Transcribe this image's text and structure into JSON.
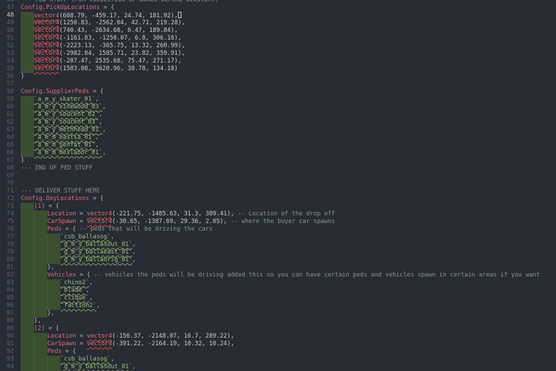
{
  "editor": {
    "current_line": 48,
    "lines": [
      {
        "n": 46,
        "indent": 0,
        "tokens": [
          [
            "comment",
            "--- PED STUFF (FOR COLLECTION OF BOXES BEFORE DELIVERY)"
          ]
        ]
      },
      {
        "n": 47,
        "indent": 0,
        "tokens": [
          [
            "field",
            "Config.PickUpLocations"
          ],
          [
            "op",
            " = {"
          ]
        ]
      },
      {
        "n": 48,
        "indent": 1,
        "tokens": [
          [
            "fn",
            "vector4"
          ],
          [
            "num",
            "(608.79, -459.17, 24.74, 181.92),"
          ]
        ],
        "cursor": true
      },
      {
        "n": 49,
        "indent": 1,
        "tokens": [
          [
            "fn",
            "vector4"
          ],
          [
            "num",
            "(1250.83, -2562.04, 42.71, 219.28),"
          ]
        ]
      },
      {
        "n": 50,
        "indent": 1,
        "tokens": [
          [
            "fn",
            "vector4"
          ],
          [
            "num",
            "(740.43, -2634.68, 6.47, 189.84),"
          ]
        ]
      },
      {
        "n": 51,
        "indent": 1,
        "tokens": [
          [
            "fn",
            "vector4"
          ],
          [
            "num",
            "(-1161.83, -1250.07, 6.8, 306.16),"
          ]
        ]
      },
      {
        "n": 52,
        "indent": 1,
        "tokens": [
          [
            "fn",
            "vector4"
          ],
          [
            "num",
            "(-2223.13, -365.75, 13.32, 260.99),"
          ]
        ]
      },
      {
        "n": 53,
        "indent": 1,
        "tokens": [
          [
            "fn",
            "vector4"
          ],
          [
            "num",
            "(-2982.84, 1585.71, 23.82, 359.91),"
          ]
        ]
      },
      {
        "n": 54,
        "indent": 1,
        "tokens": [
          [
            "fn",
            "vector4"
          ],
          [
            "num",
            "(-287.47, 2535.68, 75.47, 271.17),"
          ]
        ]
      },
      {
        "n": 55,
        "indent": 1,
        "tokens": [
          [
            "fn",
            "vector4"
          ],
          [
            "num",
            "(1583.08, 3620.96, 38.78, 134.18)"
          ]
        ]
      },
      {
        "n": 56,
        "indent": 0,
        "tokens": [
          [
            "op",
            "}"
          ]
        ]
      },
      {
        "n": 57,
        "indent": 0,
        "tokens": []
      },
      {
        "n": 58,
        "indent": 0,
        "tokens": [
          [
            "field",
            "Config.SupplierPeds"
          ],
          [
            "op",
            " = {"
          ]
        ]
      },
      {
        "n": 59,
        "indent": 1,
        "tokens": [
          [
            "str",
            "`a_m_y_skater_01`"
          ],
          [
            "op",
            ","
          ]
        ]
      },
      {
        "n": 60,
        "indent": 1,
        "tokens": [
          [
            "str",
            "`a_m_y_vinewood_03`"
          ],
          [
            "op",
            ","
          ]
        ]
      },
      {
        "n": 61,
        "indent": 1,
        "tokens": [
          [
            "str",
            "`a_m_y_soucent_02`"
          ],
          [
            "op",
            ","
          ]
        ]
      },
      {
        "n": 62,
        "indent": 1,
        "tokens": [
          [
            "str",
            "`a_m_y_soucent_03`"
          ],
          [
            "op",
            ","
          ]
        ]
      },
      {
        "n": 63,
        "indent": 1,
        "tokens": [
          [
            "str",
            "`a_m_y_methhead_01`"
          ],
          [
            "op",
            ","
          ]
        ]
      },
      {
        "n": 64,
        "indent": 1,
        "tokens": [
          [
            "str",
            "`a_m_m_eastsa_01`"
          ],
          [
            "op",
            ","
          ]
        ]
      },
      {
        "n": 65,
        "indent": 1,
        "tokens": [
          [
            "str",
            "`a_m_m_genfat_01`"
          ],
          [
            "op",
            ","
          ]
        ]
      },
      {
        "n": 66,
        "indent": 1,
        "tokens": [
          [
            "str",
            "`a_m_m_mexlabor_01`"
          ],
          [
            "op",
            ","
          ]
        ]
      },
      {
        "n": 67,
        "indent": 0,
        "tokens": [
          [
            "op",
            "}"
          ]
        ]
      },
      {
        "n": 68,
        "indent": 0,
        "tokens": [
          [
            "comment",
            "--- END OF PED STUFF"
          ]
        ]
      },
      {
        "n": 69,
        "indent": 0,
        "tokens": []
      },
      {
        "n": 70,
        "indent": 0,
        "tokens": []
      },
      {
        "n": 71,
        "indent": 0,
        "tokens": [
          [
            "comment",
            "--- DELIVER STUFF HERE"
          ]
        ]
      },
      {
        "n": 72,
        "indent": 0,
        "tokens": [
          [
            "field",
            "Config.OxyLocations"
          ],
          [
            "op",
            " = {"
          ]
        ]
      },
      {
        "n": 73,
        "indent": 1,
        "tokens": [
          [
            "field",
            "[1]"
          ],
          [
            "op",
            " = {"
          ]
        ]
      },
      {
        "n": 74,
        "indent": 2,
        "tokens": [
          [
            "field",
            "Location"
          ],
          [
            "op",
            " = "
          ],
          [
            "fn",
            "vector4"
          ],
          [
            "num",
            "(-221.75, -1485.63, 31.3, 309.41),"
          ],
          [
            "comment",
            " -- Location of the drop off"
          ]
        ]
      },
      {
        "n": 75,
        "indent": 2,
        "tokens": [
          [
            "field",
            "CarSpawn"
          ],
          [
            "op",
            " = "
          ],
          [
            "fn",
            "vector4"
          ],
          [
            "num",
            "(-30.65, -1387.69, 29.36, 2.05),"
          ],
          [
            "comment",
            " -- where the buyer car spawns"
          ]
        ]
      },
      {
        "n": 76,
        "indent": 2,
        "tokens": [
          [
            "field",
            "Peds"
          ],
          [
            "op",
            " = { "
          ],
          [
            "comment",
            "-- peds that will be driving the cars"
          ]
        ]
      },
      {
        "n": 77,
        "indent": 3,
        "tokens": [
          [
            "str",
            "`csb_ballasog`"
          ],
          [
            "op",
            ","
          ]
        ]
      },
      {
        "n": 78,
        "indent": 3,
        "tokens": [
          [
            "str",
            "`g_m_y_ballasout_01`"
          ],
          [
            "op",
            ","
          ]
        ]
      },
      {
        "n": 79,
        "indent": 3,
        "tokens": [
          [
            "str",
            "`g_m_y_ballaeast_01`"
          ],
          [
            "op",
            ","
          ]
        ]
      },
      {
        "n": 80,
        "indent": 3,
        "tokens": [
          [
            "str",
            "`g_m_y_ballaorig_01`"
          ],
          [
            "op",
            ","
          ]
        ]
      },
      {
        "n": 81,
        "indent": 2,
        "tokens": [
          [
            "op",
            "},"
          ]
        ]
      },
      {
        "n": 82,
        "indent": 2,
        "tokens": [
          [
            "field",
            "Vehicles"
          ],
          [
            "op",
            " = { "
          ],
          [
            "comment",
            "-- vehicles the peds will be driving added this so you can have certain peds and vehicles spawn in certain areas if you want"
          ]
        ]
      },
      {
        "n": 83,
        "indent": 3,
        "tokens": [
          [
            "str",
            "`chino2`"
          ],
          [
            "op",
            ","
          ]
        ]
      },
      {
        "n": 84,
        "indent": 3,
        "tokens": [
          [
            "str",
            "`blade`"
          ],
          [
            "op",
            ","
          ]
        ]
      },
      {
        "n": 85,
        "indent": 3,
        "tokens": [
          [
            "str",
            "`clique`"
          ],
          [
            "op",
            ","
          ]
        ]
      },
      {
        "n": 86,
        "indent": 3,
        "tokens": [
          [
            "str",
            "`faction2`"
          ],
          [
            "op",
            ","
          ]
        ]
      },
      {
        "n": 87,
        "indent": 2,
        "tokens": [
          [
            "op",
            "},"
          ]
        ]
      },
      {
        "n": 88,
        "indent": 1,
        "tokens": [
          [
            "op",
            "},"
          ]
        ]
      },
      {
        "n": 89,
        "indent": 1,
        "tokens": [
          [
            "field",
            "[2]"
          ],
          [
            "op",
            " = {"
          ]
        ]
      },
      {
        "n": 90,
        "indent": 2,
        "tokens": [
          [
            "field",
            "Location"
          ],
          [
            "op",
            " = "
          ],
          [
            "fn",
            "vector4"
          ],
          [
            "num",
            "(-156.37, -2148.07, 16.7, 289.22),"
          ]
        ]
      },
      {
        "n": 91,
        "indent": 2,
        "tokens": [
          [
            "field",
            "CarSpawn"
          ],
          [
            "op",
            " = "
          ],
          [
            "fn",
            "vector4"
          ],
          [
            "num",
            "(-391.22, -2164.19, 10.32, 10.24),"
          ]
        ]
      },
      {
        "n": 92,
        "indent": 2,
        "tokens": [
          [
            "field",
            "Peds"
          ],
          [
            "op",
            " = {"
          ]
        ]
      },
      {
        "n": 93,
        "indent": 3,
        "tokens": [
          [
            "str",
            "`csb_ballasog`"
          ],
          [
            "op",
            ","
          ]
        ]
      },
      {
        "n": 94,
        "indent": 3,
        "tokens": [
          [
            "str",
            "`g_m_y_ballasout_01`"
          ],
          [
            "op",
            ","
          ]
        ]
      }
    ]
  }
}
